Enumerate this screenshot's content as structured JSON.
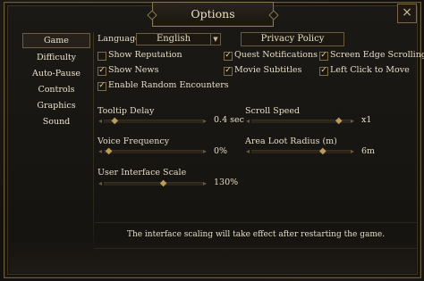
{
  "title": "Options",
  "close_icon": "close-icon",
  "sidebar": {
    "items": [
      {
        "label": "Game",
        "active": true
      },
      {
        "label": "Difficulty"
      },
      {
        "label": "Auto-Pause"
      },
      {
        "label": "Controls"
      },
      {
        "label": "Graphics"
      },
      {
        "label": "Sound"
      }
    ]
  },
  "language": {
    "label": "Language",
    "value": "English"
  },
  "privacy_button": "Privacy Policy",
  "checkboxes": [
    {
      "label": "Show Reputation",
      "checked": false
    },
    {
      "label": "Quest Notifications",
      "checked": true
    },
    {
      "label": "Screen Edge Scrolling",
      "checked": true
    },
    {
      "label": "Show News",
      "checked": true
    },
    {
      "label": "Movie Subtitles",
      "checked": true
    },
    {
      "label": "Left Click to Move",
      "checked": true
    },
    {
      "label": "Enable Random Encounters",
      "checked": true
    }
  ],
  "sliders": {
    "tooltip_delay": {
      "label": "Tooltip Delay",
      "value": "0.4 sec"
    },
    "scroll_speed": {
      "label": "Scroll Speed",
      "value": "x1"
    },
    "voice_frequency": {
      "label": "Voice Frequency",
      "value": "0%"
    },
    "area_loot_radius": {
      "label": "Area Loot Radius (m)",
      "value": "6m"
    },
    "ui_scale": {
      "label": "User Interface Scale",
      "value": "130%"
    }
  },
  "note": "The interface scaling will take effect after restarting the game."
}
